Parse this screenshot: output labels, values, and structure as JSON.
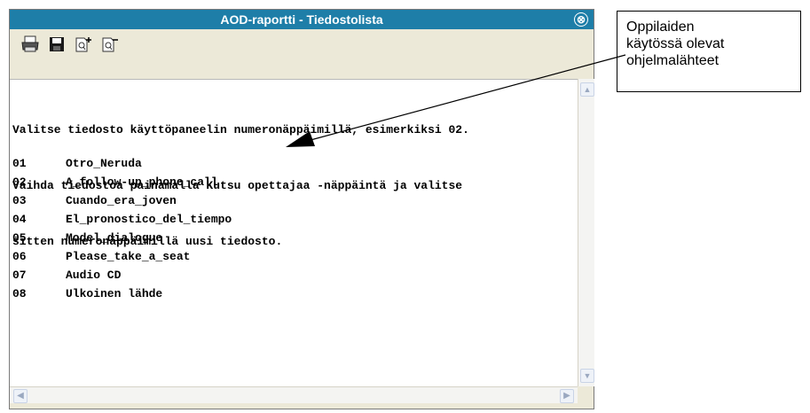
{
  "window": {
    "title": "AOD-raportti - Tiedostolista",
    "close_glyph": "⊗"
  },
  "toolbar": {
    "icons": [
      "printer-icon",
      "save-icon",
      "page-add-icon",
      "page-remove-icon"
    ]
  },
  "content": {
    "instructions": [
      "Valitse tiedosto käyttöpaneelin numeronäppäimillä, esimerkiksi 02.",
      "Vaihda tiedostoa painamalla Kutsu opettajaa -näppäintä ja valitse",
      "sitten numeronäppäimillä uusi tiedosto."
    ],
    "files": [
      {
        "num": "01",
        "name": "Otro_Neruda"
      },
      {
        "num": "02",
        "name": "A_follow-up_phone_call"
      },
      {
        "num": "03",
        "name": "Cuando_era_joven"
      },
      {
        "num": "04",
        "name": "El_pronostico_del_tiempo"
      },
      {
        "num": "05",
        "name": "Model_dialogue"
      },
      {
        "num": "06",
        "name": "Please_take_a_seat"
      },
      {
        "num": "07",
        "name": "Audio CD"
      },
      {
        "num": "08",
        "name": "Ulkoinen lähde"
      }
    ]
  },
  "callout": {
    "lines": [
      "Oppilaiden",
      "käytössä olevat",
      "ohjelmalähteet"
    ]
  },
  "colors": {
    "titlebar": "#1e7ea8",
    "window_bg": "#ece9d8"
  }
}
